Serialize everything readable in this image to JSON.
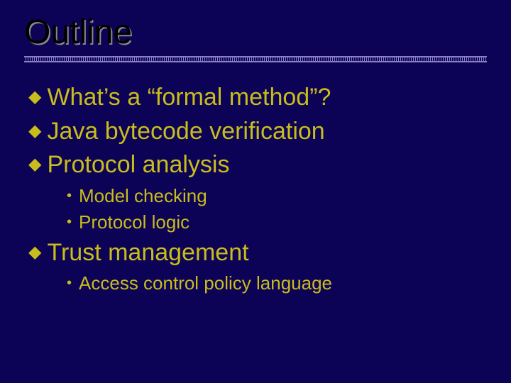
{
  "slide": {
    "title": "Outline",
    "items": [
      {
        "level": 1,
        "text": "What’s a “formal method”?"
      },
      {
        "level": 1,
        "text": "Java bytecode verification"
      },
      {
        "level": 1,
        "text": "Protocol analysis"
      },
      {
        "level": 2,
        "text": "Model checking"
      },
      {
        "level": 2,
        "text": "Protocol logic"
      },
      {
        "level": 1,
        "text": "Trust management"
      },
      {
        "level": 2,
        "text": "Access control policy language"
      }
    ]
  },
  "markers": {
    "level1": "◆",
    "level2": "•"
  }
}
